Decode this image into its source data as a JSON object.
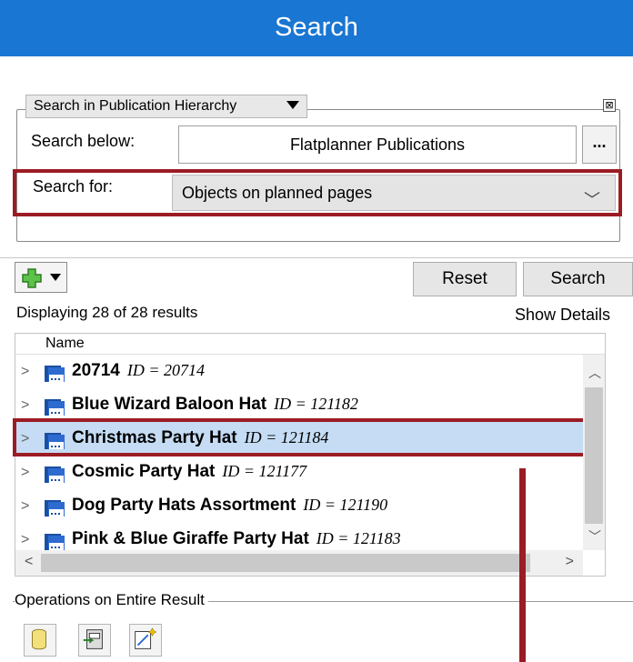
{
  "panel": {
    "title": "Search"
  },
  "search_group": {
    "scope": "Search in Publication Hierarchy",
    "close_glyph": "⊠",
    "search_below_label": "Search below:",
    "search_below_value": "Flatplanner Publications",
    "browse_label": "...",
    "search_for_label": "Search for:",
    "search_for_value": "Objects on planned pages"
  },
  "toolbar": {
    "reset_label": "Reset",
    "search_label": "Search"
  },
  "results": {
    "summary": "Displaying 28 of 28 results",
    "show_details": "Show Details",
    "column_name": "Name",
    "rows": [
      {
        "name": "20714",
        "id": "ID = 20714"
      },
      {
        "name": "Blue Wizard Baloon Hat",
        "id": "ID = 121182"
      },
      {
        "name": "Christmas Party Hat",
        "id": "ID = 121184",
        "selected": true
      },
      {
        "name": "Cosmic Party Hat",
        "id": "ID = 121177"
      },
      {
        "name": "Dog Party Hats Assortment",
        "id": "ID = 121190"
      },
      {
        "name": "Pink & Blue Giraffe Party Hat",
        "id": "ID = 121183"
      }
    ]
  },
  "operations": {
    "label": "Operations on Entire Result",
    "icons": [
      "database-icon",
      "export-icon",
      "wizard-icon"
    ]
  },
  "colors": {
    "title_bg": "#1976d2",
    "highlight": "#9b1c24",
    "selection": "#c5dcf4",
    "icon_blue": "#1a4fa3"
  }
}
